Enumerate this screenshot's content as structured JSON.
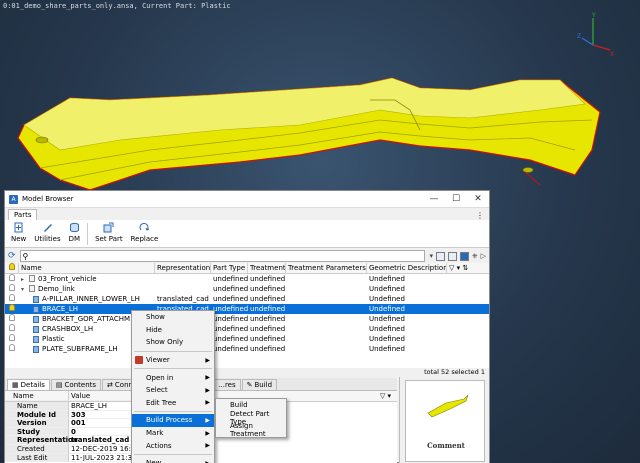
{
  "viewport": {
    "title": "0:01_demo_share_parts_only.ansa,  Current Part: Plastic",
    "colors": {
      "part": "#e6e600",
      "edge": "#d01010"
    }
  },
  "browser": {
    "title": "Model Browser",
    "window_buttons": [
      "—",
      "☐",
      "✕"
    ],
    "top_tab": "Parts",
    "kebab": "⋮",
    "toolbar": [
      {
        "label": "New",
        "icon": "new-icon"
      },
      {
        "label": "Utilities",
        "icon": "utilities-icon"
      },
      {
        "label": "DM",
        "icon": "dm-icon"
      },
      {
        "label": "Set Part",
        "icon": "set-part-icon"
      },
      {
        "label": "Replace",
        "icon": "replace-icon"
      }
    ],
    "search": {
      "value": "",
      "placeholder": ""
    },
    "columns": [
      "Name",
      "Representation",
      "Part Type",
      "Treatment",
      "Treatment Parameters",
      "Geometric Description"
    ],
    "rows": [
      {
        "name": "03_Front_vehicle",
        "rep": "",
        "type": "undefined",
        "treat": "undefined",
        "params": "",
        "geo": "Undefined",
        "kind": "group",
        "open": false,
        "indent": 0
      },
      {
        "name": "Demo_link",
        "rep": "",
        "type": "undefined",
        "treat": "undefined",
        "params": "",
        "geo": "Undefined",
        "kind": "group",
        "open": true,
        "indent": 0
      },
      {
        "name": "A-PILLAR_INNER_LOWER_LH",
        "rep": "translated_cad",
        "type": "undefined",
        "treat": "undefined",
        "params": "",
        "geo": "Undefined",
        "kind": "part",
        "indent": 1
      },
      {
        "name": "BRACE_LH",
        "rep": "translated_cad",
        "type": "undefined",
        "treat": "undefined",
        "params": "",
        "geo": "Undefined",
        "kind": "part",
        "indent": 1,
        "selected": true
      },
      {
        "name": "BRACKET_GOR_ATTACHM",
        "rep": "",
        "type": "undefined",
        "treat": "undefined",
        "params": "",
        "geo": "Undefined",
        "kind": "part",
        "indent": 1
      },
      {
        "name": "CRASHBOX_LH",
        "rep": "",
        "type": "undefined",
        "treat": "undefined",
        "params": "",
        "geo": "Undefined",
        "kind": "part",
        "indent": 1
      },
      {
        "name": "Plastic",
        "rep": "",
        "type": "undefined",
        "treat": "undefined",
        "params": "",
        "geo": "Undefined",
        "kind": "part",
        "indent": 1
      },
      {
        "name": "PLATE_SUBFRAME_LH",
        "rep": "",
        "type": "undefined",
        "treat": "undefined",
        "params": "",
        "geo": "Undefined",
        "kind": "part",
        "indent": 1
      }
    ],
    "status": "total 52  selected 1",
    "lower_tabs": [
      "Details",
      "Contents",
      "Conne",
      "...res",
      "Build"
    ],
    "details": {
      "header": {
        "name": "Name",
        "value": "Value"
      },
      "rows": [
        {
          "name": "Name",
          "value": "BRACE_LH",
          "bold": false
        },
        {
          "name": "Module Id",
          "value": "303",
          "bold": true
        },
        {
          "name": "Version",
          "value": "001",
          "bold": true
        },
        {
          "name": "Study Version",
          "value": "0",
          "bold": true
        },
        {
          "name": "Representation",
          "value": "translated_cad",
          "bold": true
        },
        {
          "name": "Created",
          "value": "12-DEC-2019 16:41",
          "bold": false
        },
        {
          "name": "Last Edit",
          "value": "11-JUL-2023 21:35",
          "bold": false
        }
      ]
    },
    "preview_label": "Comment"
  },
  "context_menu": {
    "items": [
      "Show",
      "Hide",
      "Show Only",
      "-",
      "Viewer",
      "-",
      "Open in",
      "Select",
      "Edit Tree",
      "-",
      "Build Process",
      "Mark",
      "Actions",
      "-",
      "New",
      "Modify"
    ],
    "submenu_flags": {
      "Viewer": true,
      "Open in": true,
      "Select": true,
      "Edit Tree": true,
      "Build Process": true,
      "Mark": true,
      "Actions": true,
      "New": true
    },
    "highlighted": "Build Process"
  },
  "build_submenu": {
    "items": [
      "Build",
      "Detect Part Type",
      "Assign Treatment"
    ]
  }
}
